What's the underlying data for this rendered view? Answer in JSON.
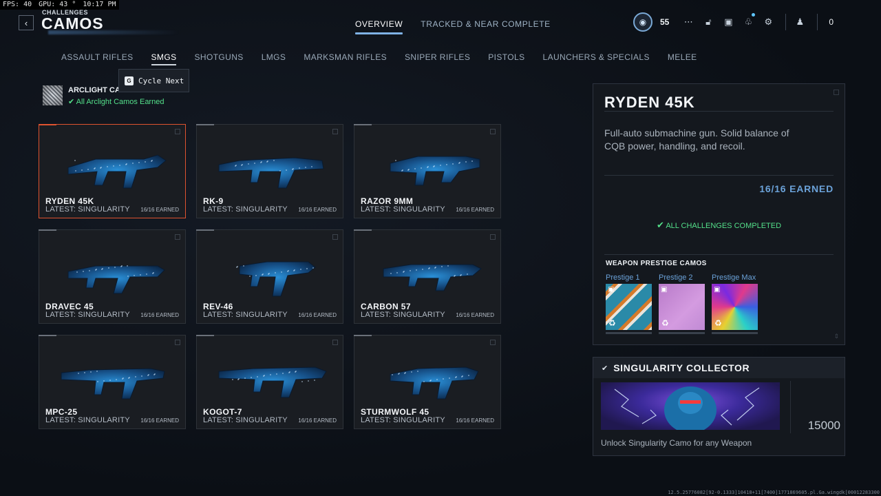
{
  "perf": {
    "fps": "FPS:  40",
    "gpu": "GPU: 43 °",
    "time": "10:17 PM"
  },
  "header": {
    "subtitle": "CHALLENGES",
    "title": "CAMOS"
  },
  "top_tabs": [
    {
      "label": "OVERVIEW",
      "active": true
    },
    {
      "label": "TRACKED & NEAR COMPLETE",
      "active": false
    }
  ],
  "top_right": {
    "rank": "55",
    "friends_count": "0"
  },
  "categories": [
    {
      "label": "ASSAULT RIFLES",
      "active": false
    },
    {
      "label": "SMGS",
      "active": true
    },
    {
      "label": "SHOTGUNS",
      "active": false
    },
    {
      "label": "LMGS",
      "active": false
    },
    {
      "label": "MARKSMAN RIFLES",
      "active": false
    },
    {
      "label": "SNIPER RIFLES",
      "active": false
    },
    {
      "label": "PISTOLS",
      "active": false
    },
    {
      "label": "LAUNCHERS & SPECIALS",
      "active": false
    },
    {
      "label": "MELEE",
      "active": false
    }
  ],
  "tooltip": {
    "key": "G",
    "text": "Cycle Next"
  },
  "arclight": {
    "title": "ARCLIGHT CAMOS",
    "status": "All Arclight Camos Earned"
  },
  "weapons": [
    {
      "name": "RYDEN 45K",
      "latest": "LATEST: SINGULARITY",
      "earned": "16/16 EARNED",
      "selected": true
    },
    {
      "name": "RK-9",
      "latest": "LATEST: SINGULARITY",
      "earned": "16/16 EARNED"
    },
    {
      "name": "RAZOR 9MM",
      "latest": "LATEST: SINGULARITY",
      "earned": "16/16 EARNED"
    },
    {
      "name": "DRAVEC 45",
      "latest": "LATEST: SINGULARITY",
      "earned": "16/16 EARNED"
    },
    {
      "name": "REV-46",
      "latest": "LATEST: SINGULARITY",
      "earned": "16/16 EARNED"
    },
    {
      "name": "CARBON 57",
      "latest": "LATEST: SINGULARITY",
      "earned": "16/16 EARNED"
    },
    {
      "name": "MPC-25",
      "latest": "LATEST: SINGULARITY",
      "earned": "16/16 EARNED"
    },
    {
      "name": "KOGOT-7",
      "latest": "LATEST: SINGULARITY",
      "earned": "16/16 EARNED"
    },
    {
      "name": "STURMWOLF 45",
      "latest": "LATEST: SINGULARITY",
      "earned": "16/16 EARNED"
    }
  ],
  "detail": {
    "title": "RYDEN 45K",
    "description": "Full-auto submachine gun. Solid balance of CQB power, handling, and recoil.",
    "earned": "16/16 EARNED",
    "complete": "ALL CHALLENGES COMPLETED",
    "prestige_heading": "WEAPON PRESTIGE CAMOS",
    "prestige": [
      {
        "label": "Prestige 1"
      },
      {
        "label": "Prestige 2"
      },
      {
        "label": "Prestige Max"
      }
    ]
  },
  "collector": {
    "title": "SINGULARITY COLLECTOR",
    "xp": "15000",
    "description": "Unlock Singularity Camo for any Weapon"
  },
  "build_id": "12.5.25776082[92-0.1333]10418+11[7400]1771869605.pl.Ga.wingdk[00012283300"
}
